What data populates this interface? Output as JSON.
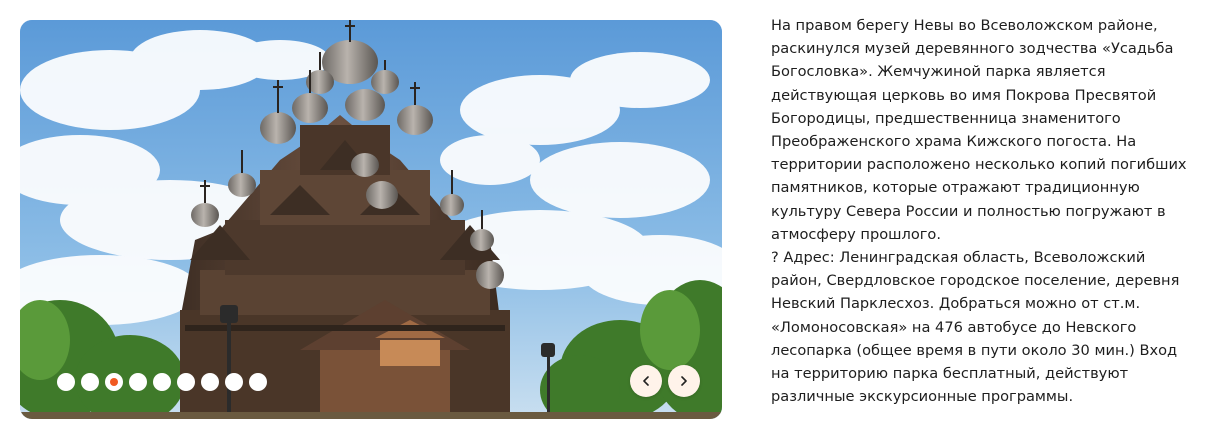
{
  "slider": {
    "image_alt": "Церковь Покрова Пресвятой Богородицы, Усадьба Богословка",
    "dots": [
      {
        "active": false
      },
      {
        "active": false
      },
      {
        "active": true
      },
      {
        "active": false
      },
      {
        "active": false
      },
      {
        "active": false
      },
      {
        "active": false
      },
      {
        "active": false
      },
      {
        "active": false
      }
    ],
    "active_dot_color": "#f15a22",
    "prev_icon": "chevron-left-icon",
    "next_icon": "chevron-right-icon"
  },
  "description": {
    "paragraph": "На правом берегу Невы во Всеволожском районе, раскинулся музей деревянного зодчества «Усадьба Богословка». Жемчужиной парка является действующая церковь во имя Покрова Пресвятой Богородицы, предшественница знаменитого Преображенского храма Кижского погоста. На территории расположено несколько копий погибших памятников, которые отражают традиционную культуру Севера России и полностью погружают в атмосферу прошлого.",
    "address": "? Адрес: Ленинградская область, Всеволожский район, Свердловское городское поселение, деревня Невский Парклесхоз. Добраться можно от ст.м. «Ломоносовская» на 476 автобусе до Невского лесопарка (общее время в пути около 30 мин.) Вход на территорию парка бесплатный, действуют различные экскурсионные программы."
  }
}
